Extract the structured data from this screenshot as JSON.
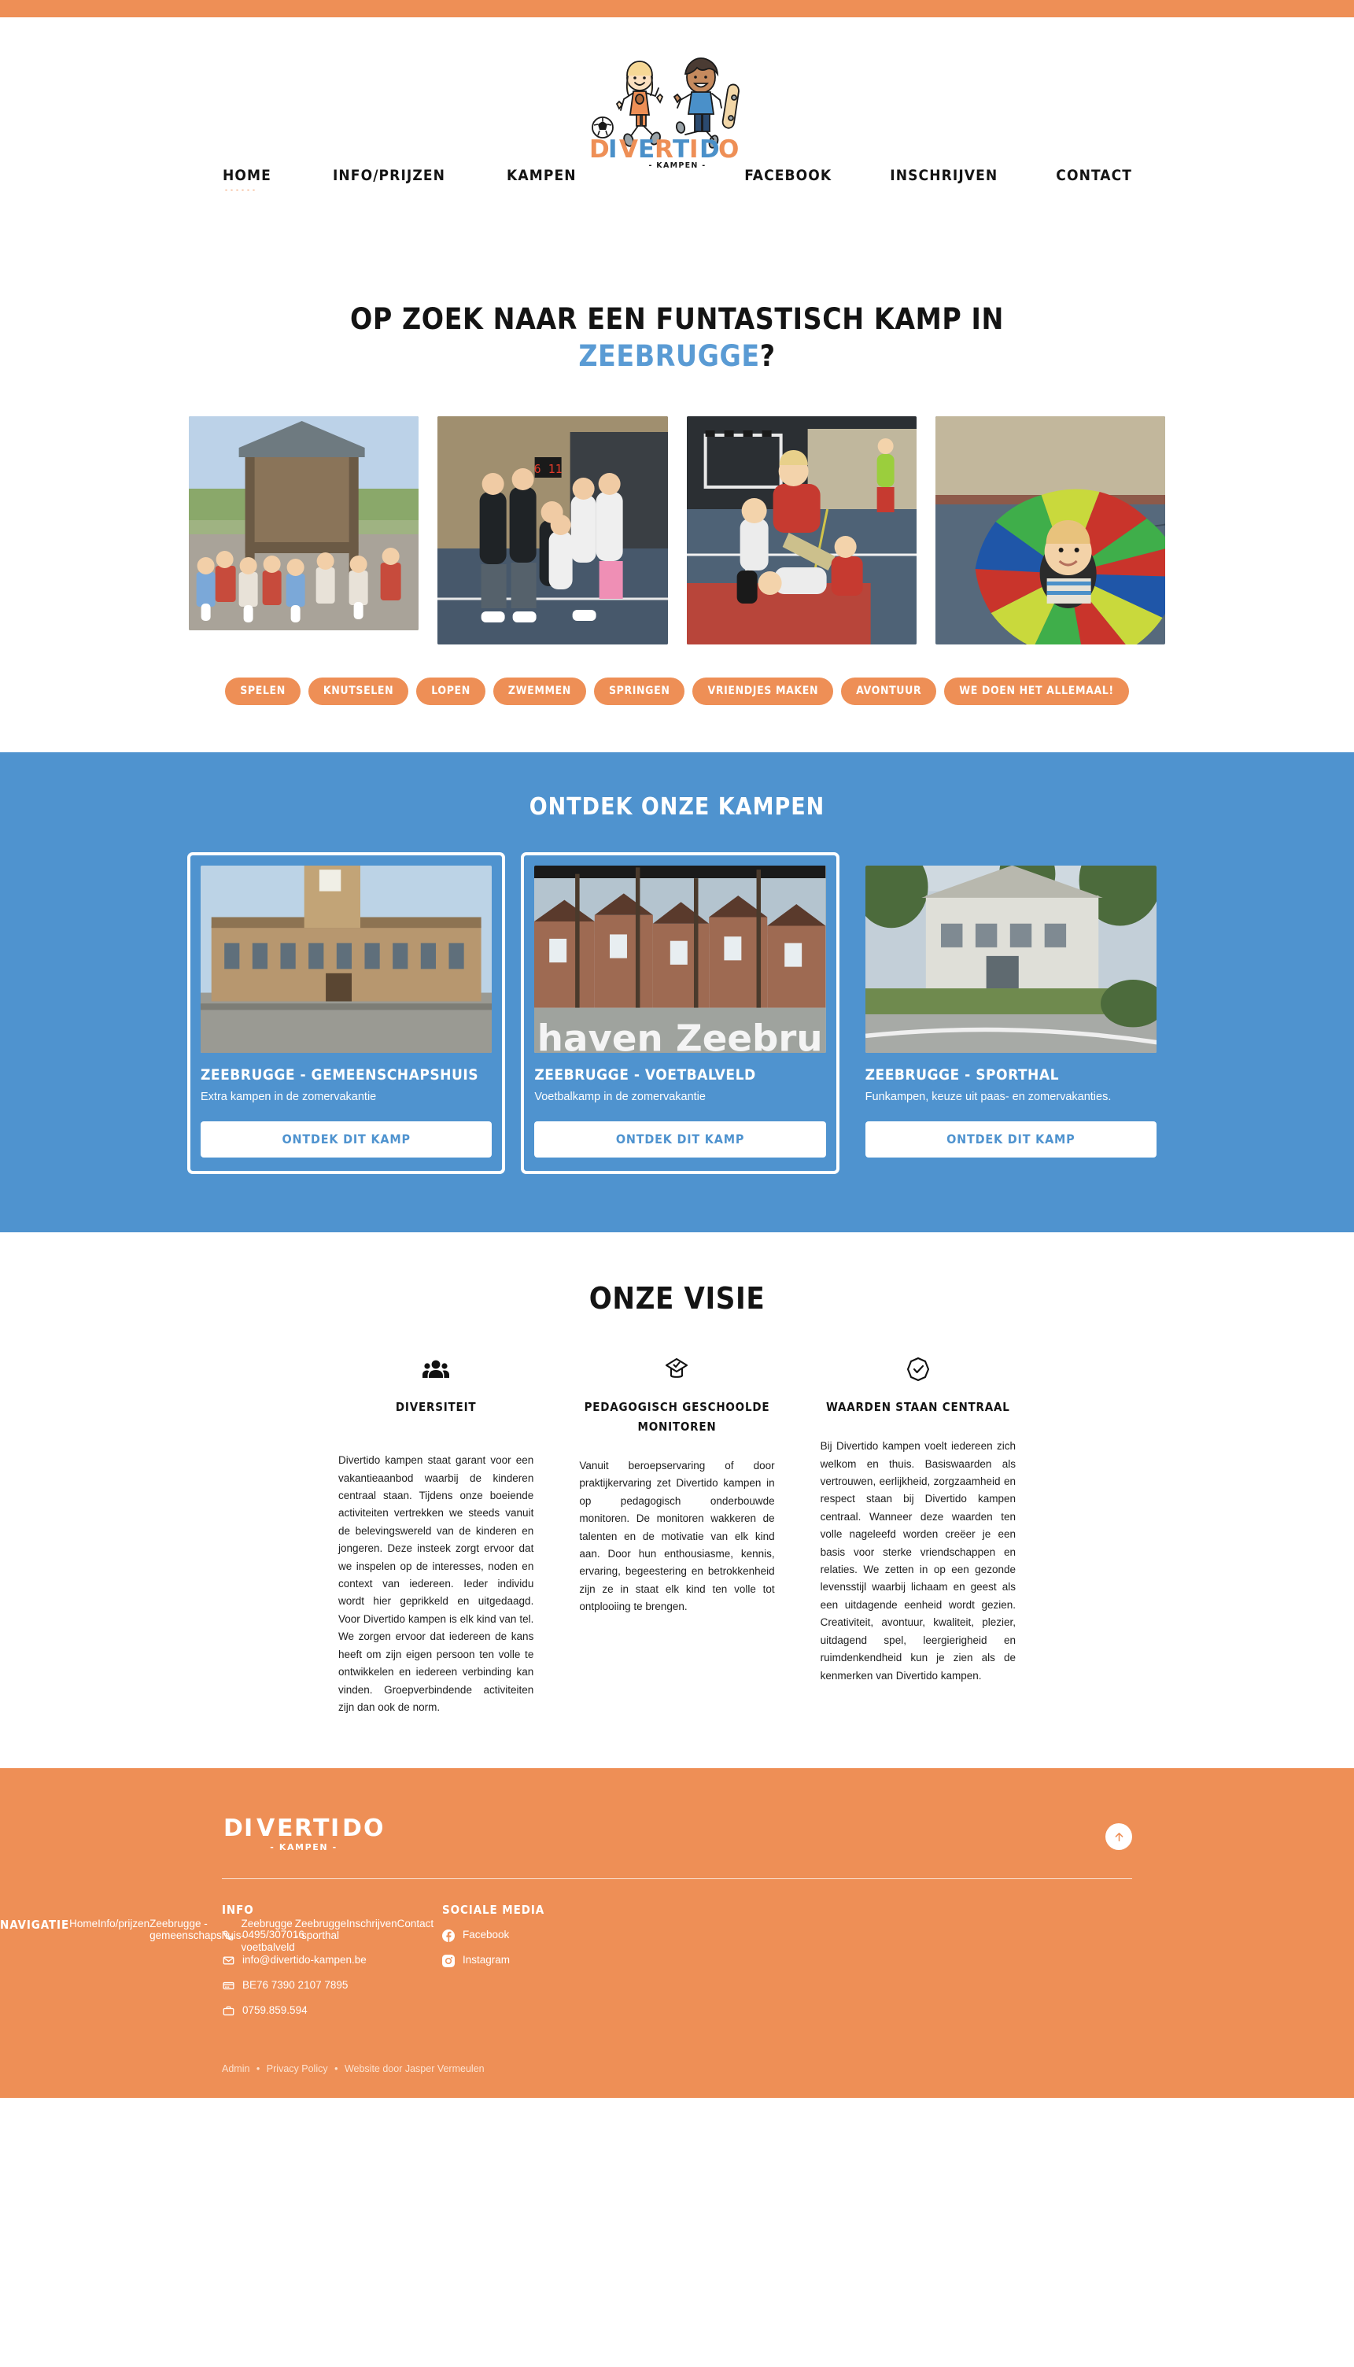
{
  "site": {
    "brand_name": "DIVERTIDO",
    "brand_sub": "- KAMPEN -",
    "accent_orange": "#ee8f56",
    "accent_blue": "#4f93cf"
  },
  "nav": {
    "left": [
      {
        "label": "Home",
        "active": true
      },
      {
        "label": "Info/Prijzen",
        "active": false
      },
      {
        "label": "Kampen",
        "active": false
      }
    ],
    "right": [
      {
        "label": "Facebook"
      },
      {
        "label": "Inschrijven"
      },
      {
        "label": "Contact"
      }
    ]
  },
  "hero": {
    "title_line1": "Op zoek naar een funtastisch kamp in",
    "title_accent": "Zeebrugge",
    "title_suffix": "?",
    "photos": [
      {
        "alt": "Kinderen op houten speeltoestel buiten"
      },
      {
        "alt": "Groepsfoto monitoren in sporthal"
      },
      {
        "alt": "Kinderen turnen op rode mat in sporthal"
      },
      {
        "alt": "Kind onder kleurrijke parachutedoek"
      }
    ],
    "tags": [
      "Spelen",
      "Knutselen",
      "Lopen",
      "zwemmen",
      "springen",
      "vriendjes maken",
      "avontuur",
      "we doen het allemaal!"
    ]
  },
  "camps": {
    "title": "Ontdek onze kampen",
    "cards": [
      {
        "name": "Zeebrugge - gemeenschapshuis",
        "desc": "Extra kampen in de zomervakantie",
        "button": "Ontdek dit kamp",
        "photo_alt": "Gemeenschapshuis gebouw met klokkentoren"
      },
      {
        "name": "Zeebrugge - voetbalveld",
        "desc": "Voetbalkamp in de zomervakantie",
        "button": "Ontdek dit kamp",
        "photo_alt": "Straatbeeld met opschrift haven Zeebrugge"
      },
      {
        "name": "Zeebrugge - sporthal",
        "desc": "Funkampen, keuze uit paas- en zomervakanties.",
        "button": "Ontdek dit kamp",
        "photo_alt": "Sporthal gebouw met parkeerplaats"
      }
    ]
  },
  "vision": {
    "title": "Onze visie",
    "columns": [
      {
        "icon": "people-group-icon",
        "heading": "Diversiteit",
        "body": "Divertido kampen staat garant voor een vakantieaanbod waarbij de kinderen centraal staan. Tijdens onze boeiende activiteiten vertrekken we steeds vanuit de belevingswereld van de kinderen en jongeren. Deze insteek zorgt ervoor dat we inspelen op de interesses, noden en context van iedereen. Ieder individu wordt hier geprikkeld en uitgedaagd. Voor Divertido kampen is elk kind van tel. We zorgen ervoor dat iedereen de kans heeft om zijn eigen persoon ten volle te ontwikkelen en iedereen verbinding kan vinden. Groepverbindende activiteiten zijn dan ook de norm."
      },
      {
        "icon": "graduation-cap-icon",
        "heading": "Pedagogisch geschoolde monitoren",
        "body": "Vanuit beroepservaring of door praktijkervaring zet Divertido kampen in op pedagogisch onderbouwde monitoren. De monitoren wakkeren de talenten en de motivatie van elk kind aan. Door hun enthousiasme, kennis, ervaring, begeestering en betrokkenheid zijn ze in staat elk kind ten volle tot ontplooiing te brengen."
      },
      {
        "icon": "check-badge-icon",
        "heading": "Waarden staan centraal",
        "body": "Bij Divertido kampen voelt iedereen zich welkom en thuis. Basiswaarden als vertrouwen, eerlijkheid, zorgzaamheid en respect staan bij Divertido kampen centraal. Wanneer deze waarden ten volle nageleefd worden creëer je een basis voor sterke vriendschappen en relaties. We zetten in op een gezonde levensstijl waarbij lichaam en geest als een uitdagende eenheid wordt gezien. Creativiteit, avontuur, kwaliteit, plezier, uitdagend spel, leergierigheid en ruimdenkendheid kun je zien als de kenmerken van Divertido kampen."
      }
    ]
  },
  "footer": {
    "to_top_label": "Naar boven",
    "info": {
      "heading": "Info",
      "rows": [
        {
          "icon": "phone-icon",
          "text": "0495/307016"
        },
        {
          "icon": "envelope-icon",
          "text": "info@divertido-kampen.be"
        },
        {
          "icon": "credit-card-icon",
          "text": "BE76 7390 2107 7895"
        },
        {
          "icon": "briefcase-icon",
          "text": "0759.859.594"
        }
      ]
    },
    "navigation": {
      "heading": "Navigatie",
      "links": [
        "Home",
        "Info/prijzen",
        "Zeebrugge - gemeenschapshuis",
        "Zeebrugge - voetbalveld",
        "Zeebrugge - sporthal",
        "Inschrijven",
        "Contact"
      ]
    },
    "social": {
      "heading": "Sociale media",
      "links": [
        {
          "icon": "facebook-icon",
          "label": "Facebook"
        },
        {
          "icon": "instagram-icon",
          "label": "Instagram"
        }
      ]
    },
    "bottom": {
      "admin": "Admin",
      "privacy": "Privacy Policy",
      "credit": "Website door Jasper Vermeulen",
      "separator": "•"
    }
  }
}
